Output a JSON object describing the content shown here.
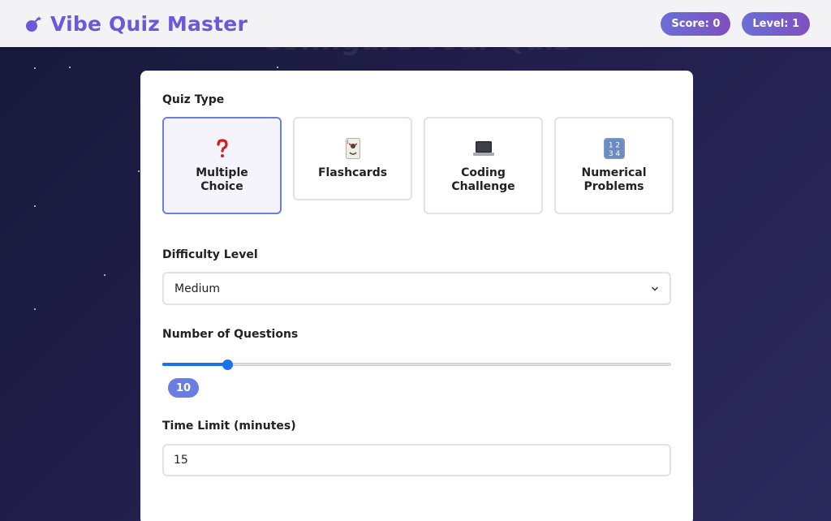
{
  "app": {
    "title": "Vibe Quiz Master",
    "background_title": "Configure Your Quiz"
  },
  "header": {
    "score_label": "Score: 0",
    "level_label": "Level: 1"
  },
  "quiz_type": {
    "label": "Quiz Type",
    "options": [
      {
        "label": "Multiple Choice",
        "icon": "question-mark-icon",
        "selected": true
      },
      {
        "label": "Flashcards",
        "icon": "joker-card-icon",
        "selected": false
      },
      {
        "label": "Coding Challenge",
        "icon": "laptop-icon",
        "selected": false
      },
      {
        "label": "Numerical Problems",
        "icon": "numbers-1234-icon",
        "selected": false
      }
    ]
  },
  "difficulty": {
    "label": "Difficulty Level",
    "selected": "Medium"
  },
  "questions": {
    "label": "Number of Questions",
    "value": "10",
    "slider_fraction": 0.12
  },
  "time_limit": {
    "label": "Time Limit (minutes)",
    "value": "15"
  },
  "colors": {
    "accent": "#6c59d9",
    "selected_border": "#6b7fe3",
    "slider": "#1a73e8",
    "background": "#1f1d45"
  }
}
